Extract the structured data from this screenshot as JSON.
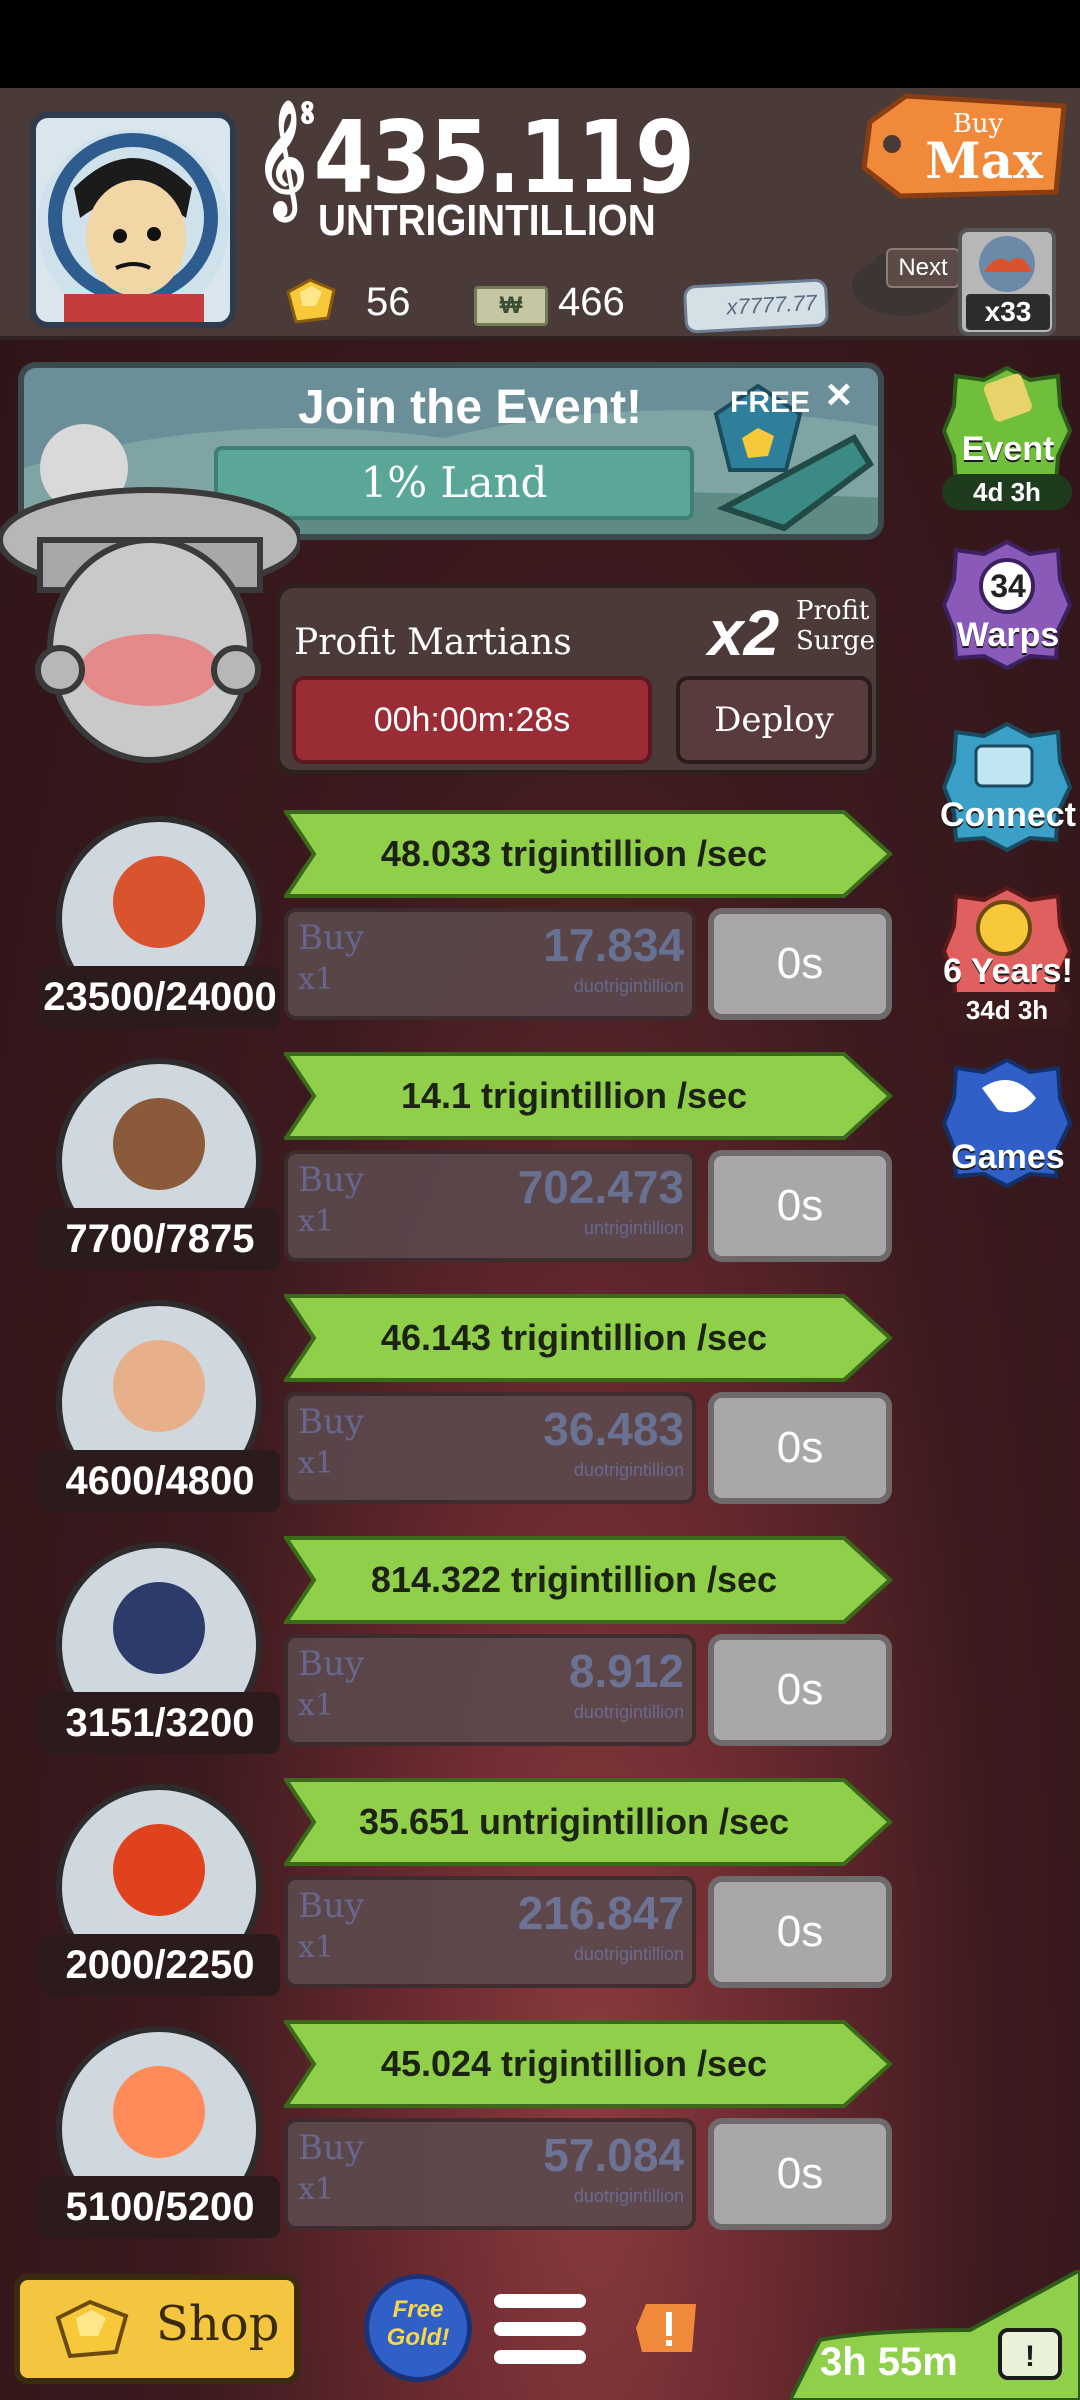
{
  "header": {
    "money_value": "435.119",
    "money_unit": "UNTRIGINTILLION",
    "gold_count": "56",
    "megabucks_count": "466",
    "multiplier_card": "x7777.77",
    "buy_top": "Buy",
    "buy_main": "Max",
    "next_label": "Next",
    "next_count": "x33"
  },
  "event": {
    "title": "Join the Event!",
    "bar_text": "1% Land",
    "free_label": "FREE",
    "close": "×"
  },
  "side": {
    "event_label": "Event",
    "event_time": "4d 3h",
    "warps_count": "34",
    "warps_label": "Warps",
    "connect_label": "Connect",
    "years_label": "6 Years!",
    "years_time": "34d 3h",
    "games_label": "Games"
  },
  "manager": {
    "title": "Profit Martians",
    "multiplier": "x2",
    "surge_line1": "Profit",
    "surge_line2": "Surge",
    "timer": "00h:00m:28s",
    "deploy": "Deploy"
  },
  "businesses": [
    {
      "count": "23500/24000",
      "rate": "48.033 trigintillion /sec",
      "buy": "Buy",
      "mult": "x1",
      "price": "17.834",
      "unit": "duotrigintillion",
      "time": "0s"
    },
    {
      "count": "7700/7875",
      "rate": "14.1 trigintillion /sec",
      "buy": "Buy",
      "mult": "x1",
      "price": "702.473",
      "unit": "untrigintillion",
      "time": "0s"
    },
    {
      "count": "4600/4800",
      "rate": "46.143 trigintillion /sec",
      "buy": "Buy",
      "mult": "x1",
      "price": "36.483",
      "unit": "duotrigintillion",
      "time": "0s"
    },
    {
      "count": "3151/3200",
      "rate": "814.322 trigintillion /sec",
      "buy": "Buy",
      "mult": "x1",
      "price": "8.912",
      "unit": "duotrigintillion",
      "time": "0s"
    },
    {
      "count": "2000/2250",
      "rate": "35.651 untrigintillion /sec",
      "buy": "Buy",
      "mult": "x1",
      "price": "216.847",
      "unit": "duotrigintillion",
      "time": "0s"
    },
    {
      "count": "5100/5200",
      "rate": "45.024 trigintillion /sec",
      "buy": "Buy",
      "mult": "x1",
      "price": "57.084",
      "unit": "duotrigintillion",
      "time": "0s"
    }
  ],
  "bottom": {
    "shop": "Shop",
    "free_gold_line1": "Free",
    "free_gold_line2": "Gold!",
    "timer": "3h 55m"
  },
  "colors": {
    "background": "#3b1a1e",
    "header": "#4a3b38",
    "rate_bar": "#8fcf4a",
    "timer_button": "#9a2c35",
    "shop_button": "#f4c640"
  },
  "icons": [
    "avatar",
    "gold-gem-icon",
    "megabucks-icon",
    "buy-max-tag",
    "next-unlock-icon",
    "event-icon",
    "warps-icon",
    "connect-icon",
    "anniversary-icon",
    "games-icon",
    "menu-icon",
    "alert-icon",
    "tv-icon"
  ]
}
